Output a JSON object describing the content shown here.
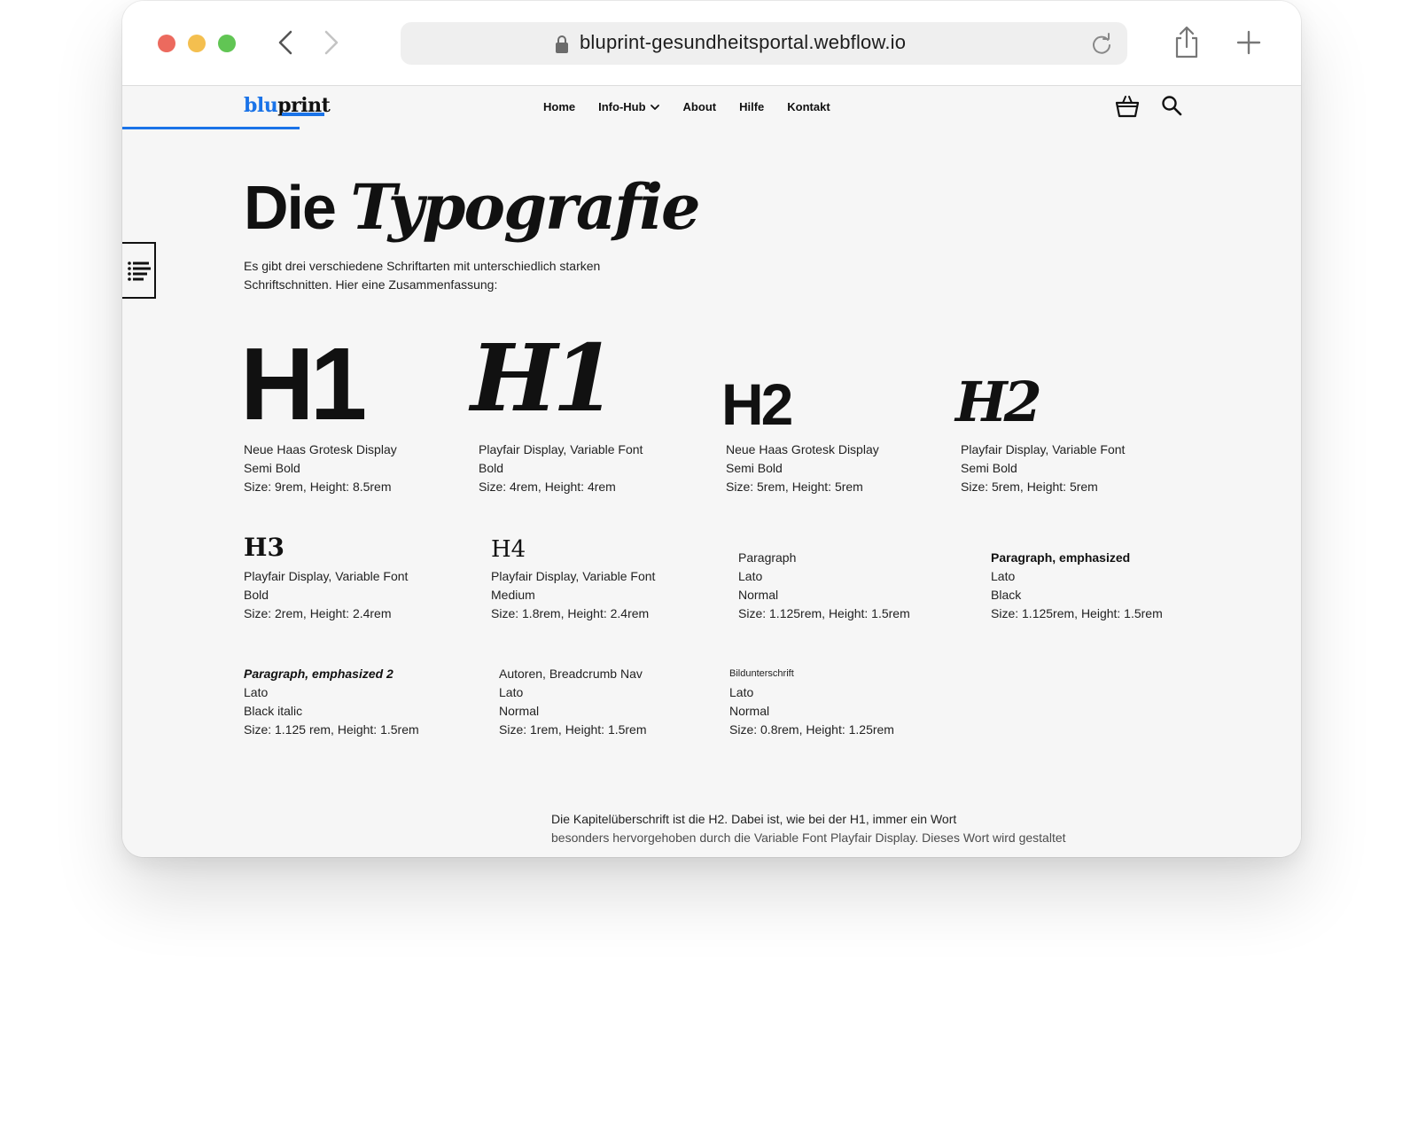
{
  "browser": {
    "url": "bluprint-gesundheitsportal.webflow.io"
  },
  "nav": {
    "logo_blu": "blu",
    "logo_print": "print",
    "links": [
      {
        "label": "Home"
      },
      {
        "label": "Info-Hub"
      },
      {
        "label": "About"
      },
      {
        "label": "Hilfe"
      },
      {
        "label": "Kontakt"
      }
    ]
  },
  "hero": {
    "title_plain": "Die",
    "title_italic": "Typografie",
    "intro": "Es gibt drei verschiedene Schriftarten mit unterschiedlich starken Schriftschnitten. Hier eine Zusammenfassung:"
  },
  "specimens": [
    {
      "sample": "H1",
      "lines": [
        "Neue Haas Grotesk Display",
        "Semi Bold",
        "Size: 9rem, Height: 8.5rem"
      ]
    },
    {
      "sample": "H1",
      "lines": [
        "Playfair Display, Variable Font",
        "Bold",
        "Size: 4rem, Height: 4rem"
      ]
    },
    {
      "sample": "H2",
      "lines": [
        "Neue Haas Grotesk Display",
        "Semi Bold",
        "Size: 5rem, Height: 5rem"
      ]
    },
    {
      "sample": "H2",
      "lines": [
        "Playfair Display, Variable Font",
        "Semi Bold",
        "Size: 5rem, Height: 5rem"
      ]
    },
    {
      "sample": "H3",
      "lines": [
        "Playfair Display, Variable Font",
        "Bold",
        "Size: 2rem, Height: 2.4rem"
      ]
    },
    {
      "sample": "H4",
      "lines": [
        "Playfair Display, Variable Font",
        "Medium",
        "Size: 1.8rem, Height: 2.4rem"
      ]
    },
    {
      "title": "Paragraph",
      "lines": [
        "Lato",
        "Normal",
        "Size: 1.125rem, Height: 1.5rem"
      ]
    },
    {
      "title": "Paragraph, emphasized",
      "lines": [
        "Lato",
        "Black",
        "Size: 1.125rem, Height: 1.5rem"
      ]
    },
    {
      "title": "Paragraph, emphasized 2",
      "lines": [
        "Lato",
        "Black italic",
        "Size: 1.125 rem, Height: 1.5rem"
      ]
    },
    {
      "title": "Autoren, Breadcrumb Nav",
      "lines": [
        "Lato",
        "Normal",
        "Size: 1rem, Height: 1.5rem"
      ]
    },
    {
      "title": "Bildunterschrift",
      "lines": [
        "Lato",
        "Normal",
        "Size: 0.8rem, Height: 1.25rem"
      ]
    }
  ],
  "footer_text": {
    "line1": "Die Kapitelüberschrift ist die H2. Dabei ist, wie bei der H1, immer ein Wort",
    "line2": "besonders hervorgehoben durch die Variable Font Playfair Display. Dieses Wort wird gestaltet"
  }
}
